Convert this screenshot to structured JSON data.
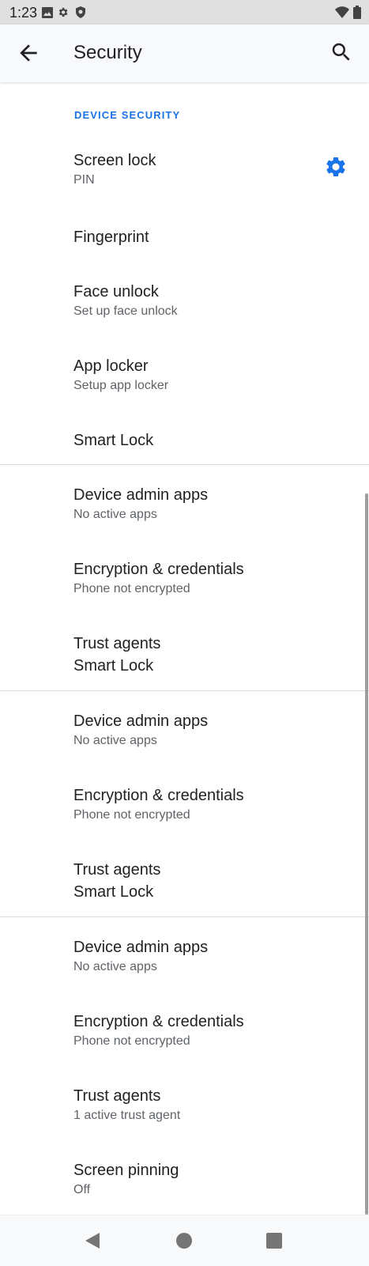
{
  "status_bar": {
    "time": "1:23",
    "left_icons": [
      "image-icon",
      "gear-icon",
      "shield-icon"
    ],
    "right_icons": [
      "wifi-icon",
      "battery-icon"
    ]
  },
  "app_bar": {
    "title": "Security",
    "back_icon": "arrow-left-icon",
    "search_icon": "search-icon"
  },
  "section_header": "DEVICE SECURITY",
  "accent_color": "#1a73e8",
  "items": [
    {
      "title": "Screen lock",
      "subtitle": "PIN"
    },
    {
      "title": "Fingerprint",
      "subtitle": ""
    },
    {
      "title": "Face unlock",
      "subtitle": "Set up face unlock"
    },
    {
      "title": "App locker",
      "subtitle": "Setup app locker"
    },
    {
      "title": "Smart Lock",
      "subtitle": ""
    },
    {
      "title": "Device admin apps",
      "subtitle": "No active apps"
    },
    {
      "title": "Encryption & credentials",
      "subtitle": "Phone not encrypted"
    },
    {
      "title": "Trust agents",
      "subtitle": "Smart Lock"
    },
    {
      "title": "Device admin apps",
      "subtitle": "No active apps"
    },
    {
      "title": "Encryption & credentials",
      "subtitle": "Phone not encrypted"
    },
    {
      "title": "Trust agents",
      "subtitle": "Smart Lock"
    },
    {
      "title": "Device admin apps",
      "subtitle": "No active apps"
    },
    {
      "title": "Encryption & credentials",
      "subtitle": "Phone not encrypted"
    },
    {
      "title": "Trust agents",
      "subtitle": "1 active trust agent"
    },
    {
      "title": "Screen pinning",
      "subtitle": "Off"
    }
  ],
  "nav_bar": {
    "buttons": [
      "back-triangle-icon",
      "home-circle-icon",
      "recents-square-icon"
    ]
  }
}
